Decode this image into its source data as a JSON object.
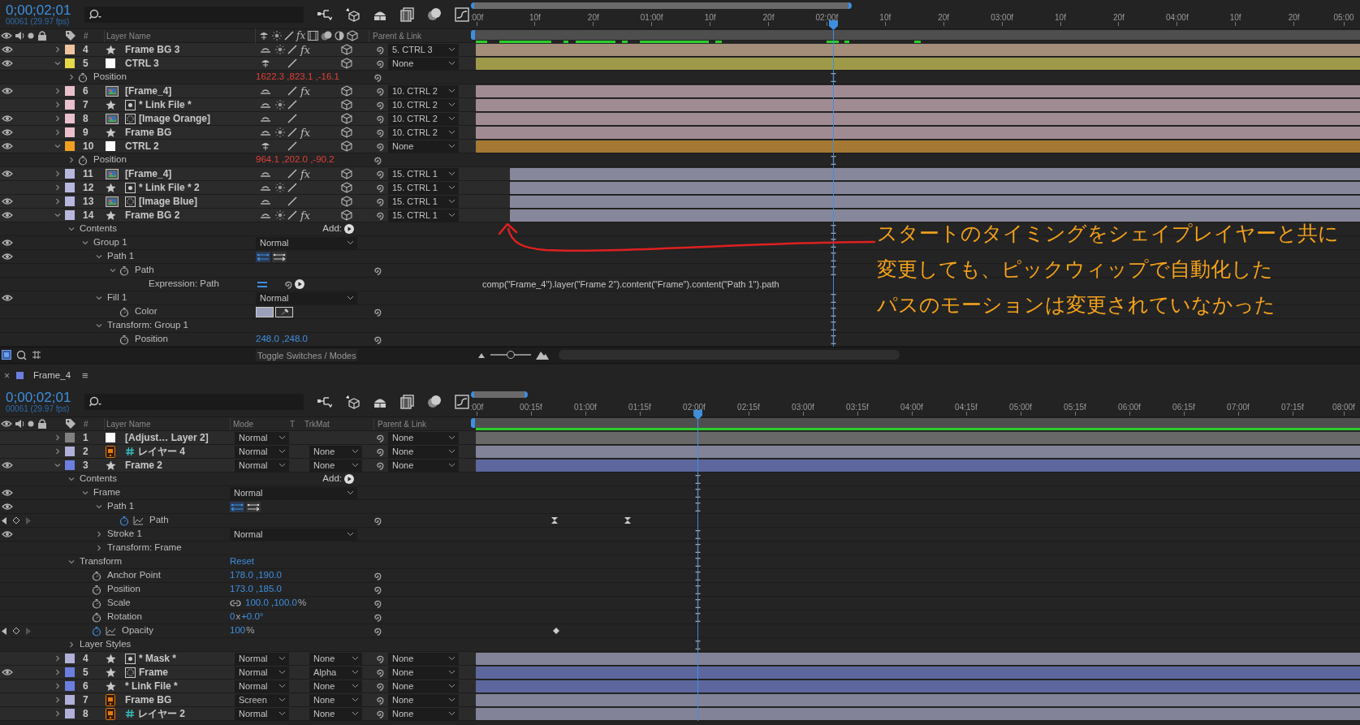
{
  "top": {
    "time": "0;00;02;01",
    "fps": "00061 (29.97 fps)",
    "columns": {
      "number": "#",
      "name": "Layer Name",
      "fx": "fx",
      "parent": "Parent & Link"
    },
    "ruler": [
      ":00f",
      "10f",
      "20f",
      "01:00f",
      "10f",
      "20f",
      "02:00f",
      "10f",
      "20f",
      "03:00f",
      "10f",
      "20f",
      "04:00f",
      "10f",
      "20f",
      "05:00"
    ],
    "layers": [
      {
        "kind": "shape",
        "number": "4",
        "name": "Frame BG 3",
        "color": "#eec4a0",
        "visible": true,
        "expanded": false,
        "collapse": true,
        "effects": "fx",
        "trimmed_start": false,
        "parent": "5. CTRL 3"
      },
      {
        "kind": "null",
        "number": "5",
        "name": "CTRL 3",
        "color": "#e5d94a",
        "visible": true,
        "expanded": true,
        "collapse": false,
        "trimmed_start": false,
        "parent": "None",
        "children": [
          {
            "kind": "property",
            "name": "Position",
            "expanded": false,
            "animated": false,
            "value": [
              {
                "text": "1622.3 ,823.1 ,-16.1",
                "unit": false
              }
            ],
            "expression_driven": true,
            "pickwhip": true
          }
        ]
      },
      {
        "kind": "footage",
        "number": "6",
        "name": "[Frame_4]",
        "color": "#e8c1cc",
        "visible": true,
        "expanded": false,
        "collapse": false,
        "effects": "fx",
        "trimmed_start": false,
        "parent": "10. CTRL 2"
      },
      {
        "kind": "shape",
        "badge": {
          "kind": "dot"
        },
        "number": "7",
        "name": "* Link File *",
        "color": "#e8c1cc",
        "visible": false,
        "expanded": false,
        "collapse": true,
        "trimmed_start": false,
        "parent": "10. CTRL 2"
      },
      {
        "kind": "footage",
        "badge": {
          "kind": "dashed"
        },
        "number": "8",
        "name": "[Image Orange]",
        "color": "#e8c1cc",
        "visible": true,
        "expanded": false,
        "collapse": false,
        "trimmed_start": false,
        "parent": "10. CTRL 2"
      },
      {
        "kind": "shape",
        "number": "9",
        "name": "Frame BG",
        "color": "#e8c1cc",
        "visible": true,
        "expanded": false,
        "collapse": true,
        "effects": "fx",
        "trimmed_start": false,
        "parent": "10. CTRL 2"
      },
      {
        "kind": "null",
        "number": "10",
        "name": "CTRL 2",
        "color": "#f0a020",
        "visible": true,
        "expanded": true,
        "collapse": false,
        "trimmed_start": false,
        "parent": "None",
        "children": [
          {
            "kind": "property",
            "name": "Position",
            "expanded": false,
            "animated": false,
            "value": [
              {
                "text": "964.1 ,202.0 ,-90.2",
                "unit": false
              }
            ],
            "expression_driven": true,
            "pickwhip": true
          }
        ]
      },
      {
        "kind": "footage",
        "number": "11",
        "name": "[Frame_4]",
        "color": "#b8b8de",
        "visible": true,
        "expanded": false,
        "collapse": false,
        "effects": "fx",
        "trimmed_start": true,
        "parent": "15. CTRL 1"
      },
      {
        "kind": "shape",
        "badge": {
          "kind": "dot"
        },
        "number": "12",
        "name": "* Link File * 2",
        "color": "#b8b8de",
        "visible": false,
        "expanded": false,
        "collapse": true,
        "trimmed_start": true,
        "parent": "15. CTRL 1"
      },
      {
        "kind": "footage",
        "badge": {
          "kind": "dashed"
        },
        "number": "13",
        "name": "[Image Blue]",
        "color": "#b8b8de",
        "visible": true,
        "expanded": false,
        "collapse": false,
        "trimmed_start": true,
        "parent": "15. CTRL 1"
      },
      {
        "kind": "shape",
        "number": "14",
        "name": "Frame BG 2",
        "color": "#b8b8de",
        "visible": true,
        "expanded": true,
        "collapse": true,
        "effects": "fx",
        "trimmed_start": true,
        "parent": "15. CTRL 1",
        "children": [
          {
            "kind": "section",
            "name": "Contents",
            "expanded": true,
            "add": "Add:",
            "children": [
              {
                "kind": "group",
                "name": "Group 1",
                "visible": true,
                "expanded": true,
                "mode": "Normal",
                "children": [
                  {
                    "kind": "pathgroup",
                    "name": "Path 1",
                    "visible": true,
                    "expanded": true,
                    "children": [
                      {
                        "kind": "property",
                        "name": "Path",
                        "expanded": true,
                        "animated": false,
                        "pickwhip": true,
                        "children": [
                          {
                            "kind": "expression",
                            "name": "Expression: Path",
                            "expression": "comp(\"Frame_4\").layer(\"Frame 2\").content(\"Frame\").content(\"Path 1\").path"
                          }
                        ]
                      }
                    ]
                  },
                  {
                    "kind": "group",
                    "name": "Fill 1",
                    "visible": true,
                    "expanded": true,
                    "mode": "Normal",
                    "children": [
                      {
                        "kind": "color",
                        "name": "Color",
                        "animated": false,
                        "color": "#9ba1ba",
                        "pickwhip": true
                      }
                    ]
                  },
                  {
                    "kind": "section",
                    "name": "Transform: Group 1",
                    "expanded": true,
                    "children": [
                      {
                        "kind": "property",
                        "name": "Position",
                        "animated": false,
                        "value": [
                          {
                            "text": "248.0 ,248.0",
                            "unit": false
                          }
                        ],
                        "expression_driven": false,
                        "pickwhip": true
                      }
                    ]
                  }
                ]
              }
            ]
          }
        ]
      }
    ],
    "toggle_label": "Toggle Switches / Modes",
    "zoom": {
      "level": 0.5
    }
  },
  "bottom": {
    "tab": {
      "close": "×",
      "title": "Frame_4",
      "color": "#6c7fe0",
      "menu": "≡"
    },
    "time": "0;00;02;01",
    "fps": "00061 (29.97 fps)",
    "columns": {
      "number": "#",
      "name": "Layer Name",
      "mode": "Mode",
      "t": "T",
      "trkmat": "TrkMat",
      "parent": "Parent & Link"
    },
    "ruler": [
      ":00f",
      "00:15f",
      "01:00f",
      "01:15f",
      "02:00f",
      "02:15f",
      "03:00f",
      "03:15f",
      "04:00f",
      "04:15f",
      "05:00f",
      "05:15f",
      "06:00f",
      "06:15f",
      "07:00f",
      "07:15f",
      "08:00f"
    ],
    "layers": [
      {
        "kind": "solid",
        "number": "1",
        "name": "[Adjust… Layer 2]",
        "color": "#808080",
        "visible": false,
        "expanded": false,
        "mode": "Normal",
        "parent": "None"
      },
      {
        "kind": "ai",
        "badge": {
          "kind": "hash"
        },
        "number": "2",
        "name": "レイヤー 4",
        "color": "#b0b0d8",
        "visible": false,
        "expanded": false,
        "mode": "Normal",
        "trkmat": "None",
        "parent": "None"
      },
      {
        "kind": "shape",
        "number": "3",
        "name": "Frame 2",
        "color": "#6c7fe0",
        "visible": true,
        "expanded": true,
        "mode": "Normal",
        "trkmat": "None",
        "parent": "None",
        "children": [
          {
            "kind": "section",
            "name": "Contents",
            "expanded": true,
            "add": "Add:",
            "children": [
              {
                "kind": "group",
                "name": "Frame",
                "visible": true,
                "expanded": true,
                "mode": "Normal",
                "children": [
                  {
                    "kind": "pathgroup",
                    "name": "Path 1",
                    "visible": true,
                    "expanded": true,
                    "children": [
                      {
                        "kind": "property",
                        "name": "Path",
                        "animated": true,
                        "pickwhip": true
                      }
                    ]
                  },
                  {
                    "kind": "group",
                    "name": "Stroke 1",
                    "visible": true,
                    "expanded": false,
                    "mode": "Normal"
                  },
                  {
                    "kind": "section",
                    "name": "Transform: Frame",
                    "expanded": false
                  }
                ]
              }
            ]
          },
          {
            "kind": "section",
            "name": "Transform",
            "expanded": true,
            "reset": "Reset",
            "children": [
              {
                "kind": "property",
                "name": "Anchor Point",
                "animated": false,
                "value": [
                  {
                    "text": "178.0 ,190.0",
                    "unit": false
                  }
                ],
                "expression_driven": false,
                "pickwhip": true
              },
              {
                "kind": "property",
                "name": "Position",
                "animated": false,
                "value": [
                  {
                    "text": "173.0 ,185.0",
                    "unit": false
                  }
                ],
                "expression_driven": false,
                "pickwhip": true
              },
              {
                "kind": "property",
                "name": "Scale",
                "animated": false,
                "constrained": true,
                "value": [
                  {
                    "text": "100.0 ,100.0",
                    "unit": false
                  },
                  {
                    "text": "%",
                    "unit": true
                  }
                ],
                "expression_driven": false,
                "pickwhip": true
              },
              {
                "kind": "property",
                "name": "Rotation",
                "animated": false,
                "value": [
                  {
                    "text": "0",
                    "unit": false
                  },
                  {
                    "text": "x",
                    "unit": true
                  },
                  {
                    "text": "+0.0°",
                    "unit": false
                  }
                ],
                "expression_driven": false,
                "pickwhip": true
              },
              {
                "kind": "property",
                "name": "Opacity",
                "animated": true,
                "value": [
                  {
                    "text": "100",
                    "unit": false
                  },
                  {
                    "text": "%",
                    "unit": true
                  }
                ],
                "expression_driven": false,
                "pickwhip": true
              }
            ]
          },
          {
            "kind": "section",
            "name": "Layer Styles",
            "expanded": false
          }
        ]
      },
      {
        "kind": "shape",
        "badge": {
          "kind": "dot"
        },
        "number": "4",
        "name": "* Mask *",
        "color": "#b0b0d8",
        "visible": false,
        "expanded": false,
        "mode": "Normal",
        "trkmat": "None",
        "parent": "None"
      },
      {
        "kind": "shape",
        "badge": {
          "kind": "dashed"
        },
        "number": "5",
        "name": "Frame",
        "color": "#6c7fe0",
        "visible": true,
        "expanded": false,
        "mode": "Normal",
        "trkmat": "Alpha",
        "parent": "None"
      },
      {
        "kind": "shape",
        "number": "6",
        "name": "* Link File *",
        "color": "#6c7fe0",
        "visible": false,
        "expanded": false,
        "mode": "Normal",
        "trkmat": "None",
        "parent": "None"
      },
      {
        "kind": "ai",
        "number": "7",
        "name": "Frame BG",
        "color": "#b0b0d8",
        "visible": false,
        "expanded": false,
        "mode": "Screen",
        "trkmat": "None",
        "parent": "None"
      },
      {
        "kind": "ai",
        "badge": {
          "kind": "hash"
        },
        "number": "8",
        "name": "レイヤー 2",
        "color": "#b0b0d8",
        "visible": false,
        "expanded": false,
        "mode": "Normal",
        "trkmat": "None",
        "parent": "None"
      }
    ]
  },
  "annotation": {
    "lines": [
      "スタートのタイミングをシェイプレイヤーと共に",
      "変更しても、ピックウィップで自動化した",
      "パスのモーションは変更されていなかった"
    ]
  }
}
